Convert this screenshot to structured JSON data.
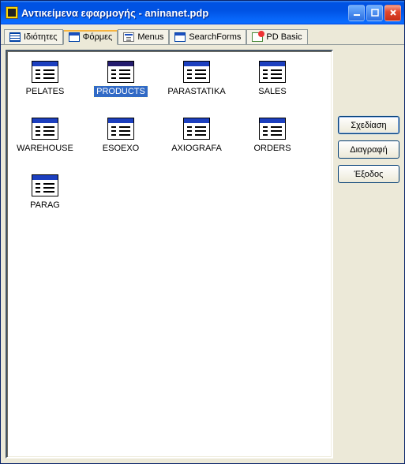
{
  "title": "Αντικείμενα εφαρμογής - aninanet.pdp",
  "tabs": {
    "properties": "Ιδιότητες",
    "forms": "Φόρμες",
    "menus": "Menus",
    "searchforms": "SearchForms",
    "pdbasic": "PD Basic"
  },
  "items": [
    {
      "label": "PELATES",
      "selected": false
    },
    {
      "label": "PRODUCTS",
      "selected": true
    },
    {
      "label": "PARASTATIKA",
      "selected": false
    },
    {
      "label": "SALES",
      "selected": false
    },
    {
      "label": "WAREHOUSE",
      "selected": false
    },
    {
      "label": "ESOEXO",
      "selected": false
    },
    {
      "label": "AXIOGRAFA",
      "selected": false
    },
    {
      "label": "ORDERS",
      "selected": false
    },
    {
      "label": "PARAG",
      "selected": false
    }
  ],
  "buttons": {
    "design": "Σχεδίαση",
    "delete": "Διαγραφή",
    "exit": "Έξοδος"
  }
}
